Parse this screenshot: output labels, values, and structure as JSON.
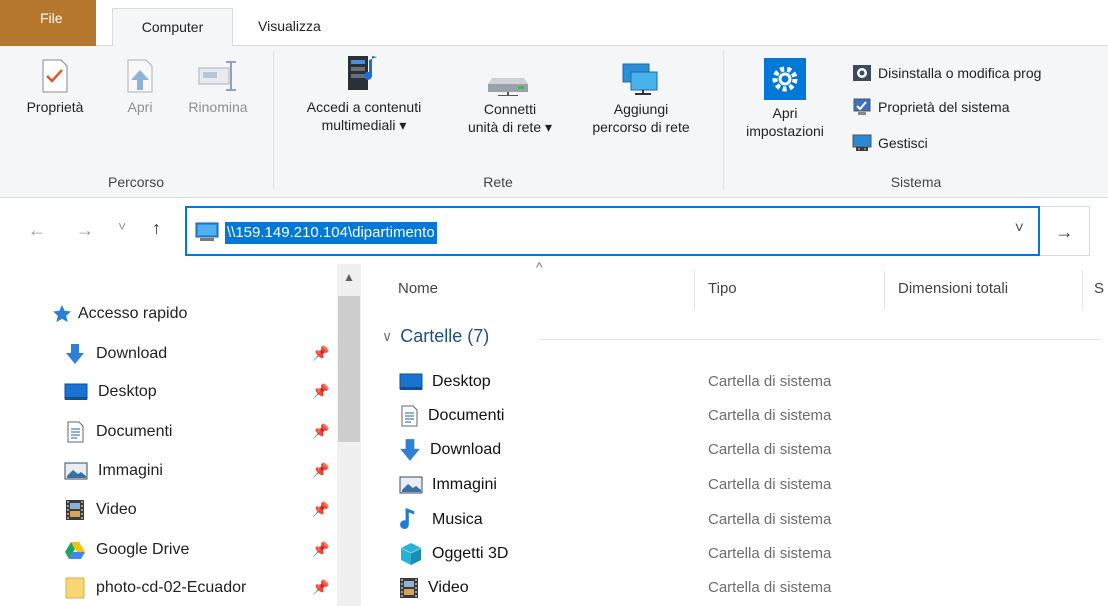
{
  "ribbon": {
    "tabs": {
      "file": "File",
      "computer": "Computer",
      "view": "Visualizza"
    },
    "groups": {
      "location": {
        "label": "Percorso",
        "properties": "Proprietà",
        "open": "Apri",
        "rename": "Rinomina"
      },
      "network": {
        "label": "Rete",
        "media_line1": "Accedi a contenuti",
        "media_line2": "multimediali ▾",
        "map_line1": "Connetti",
        "map_line2": "unità di rete ▾",
        "add_line1": "Aggiungi",
        "add_line2": "percorso di rete"
      },
      "system": {
        "label": "Sistema",
        "settings_line1": "Apri",
        "settings_line2": "impostazioni",
        "uninstall": "Disinstalla o modifica prog",
        "sys_props": "Proprietà del sistema",
        "manage": "Gestisci"
      }
    }
  },
  "address": {
    "path": "\\\\159.149.210.104\\dipartimento",
    "back_icon": "←",
    "forward_icon": "→",
    "recent_icon": "˅",
    "up_icon": "↑",
    "dropdown_icon": "˅",
    "go_icon": "→"
  },
  "nav_pane": {
    "header": "Accesso rapido",
    "items": [
      {
        "label": "Download"
      },
      {
        "label": "Desktop"
      },
      {
        "label": "Documenti"
      },
      {
        "label": "Immagini"
      },
      {
        "label": "Video"
      },
      {
        "label": "Google Drive"
      },
      {
        "label": "photo-cd-02-Ecuador"
      }
    ]
  },
  "content": {
    "columns": [
      "Nome",
      "Tipo",
      "Dimensioni totali",
      "S"
    ],
    "group_title": "Cartelle (7)",
    "rows": [
      {
        "name": "Desktop",
        "type": "Cartella di sistema"
      },
      {
        "name": "Documenti",
        "type": "Cartella di sistema"
      },
      {
        "name": "Download",
        "type": "Cartella di sistema"
      },
      {
        "name": "Immagini",
        "type": "Cartella di sistema"
      },
      {
        "name": "Musica",
        "type": "Cartella di sistema"
      },
      {
        "name": "Oggetti 3D",
        "type": "Cartella di sistema"
      },
      {
        "name": "Video",
        "type": "Cartella di sistema"
      }
    ]
  },
  "colors": {
    "accent": "#0078d7",
    "file_tab": "#b5772d",
    "ribbon_bg": "#f5f6f7",
    "group_title": "#1e4e8c"
  }
}
